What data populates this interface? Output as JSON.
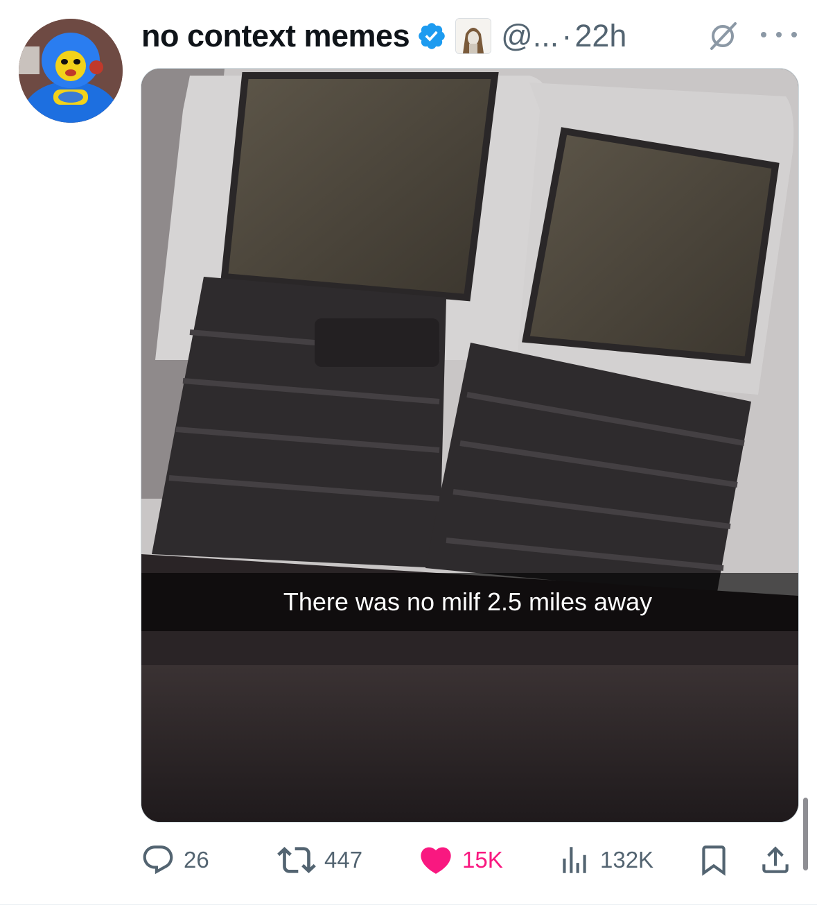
{
  "post": {
    "author_name": "no context memes",
    "handle": "@...",
    "separator": "·",
    "time": "22h",
    "caption": "There was no milf 2.5 miles away"
  },
  "actions": {
    "replies": "26",
    "reposts": "447",
    "likes": "15K",
    "views": "132K"
  },
  "colors": {
    "verified": "#1d9bf0",
    "like": "#f91880",
    "secondary_text": "#536471"
  },
  "icons": [
    "verified-badge-icon",
    "affiliate-badge-icon",
    "grok-icon",
    "more-icon",
    "reply-icon",
    "repost-icon",
    "like-icon",
    "views-icon",
    "bookmark-icon",
    "share-icon"
  ]
}
